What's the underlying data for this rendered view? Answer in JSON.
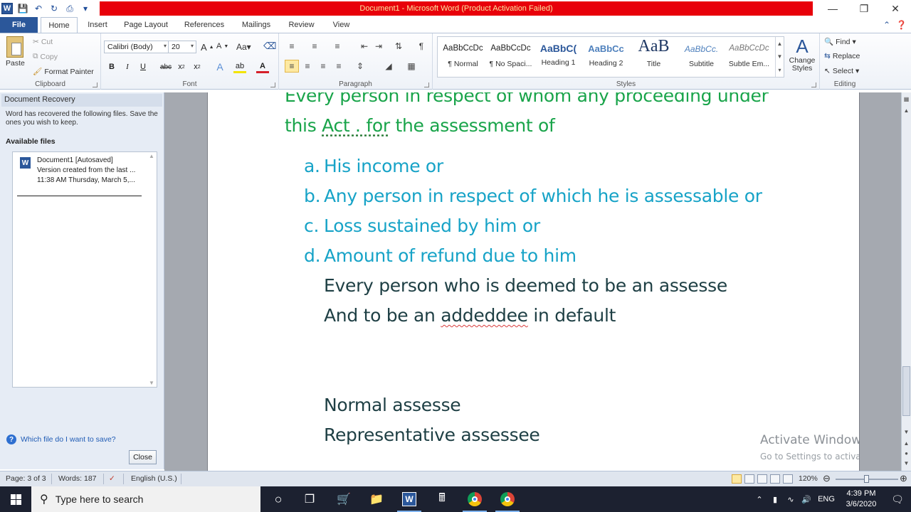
{
  "titlebar": {
    "title": "Document1  -  Microsoft Word (Product Activation Failed)"
  },
  "ribbon_tabs": [
    "File",
    "Home",
    "Insert",
    "Page Layout",
    "References",
    "Mailings",
    "Review",
    "View"
  ],
  "clipboard": {
    "paste": "Paste",
    "cut": "Cut",
    "copy": "Copy",
    "format_painter": "Format Painter",
    "group_label": "Clipboard"
  },
  "font": {
    "font_name": "Calibri (Body)",
    "font_size": "20",
    "group_label": "Font"
  },
  "paragraph": {
    "group_label": "Paragraph"
  },
  "styles": {
    "items": [
      {
        "preview": "AaBbCcDc",
        "name": "¶ Normal"
      },
      {
        "preview": "AaBbCcDc",
        "name": "¶ No Spaci..."
      },
      {
        "preview": "AaBbC(",
        "name": "Heading 1"
      },
      {
        "preview": "AaBbCc",
        "name": "Heading 2"
      },
      {
        "preview": "AaB",
        "name": "Title"
      },
      {
        "preview": "AaBbCc.",
        "name": "Subtitle"
      },
      {
        "preview": "AaBbCcDc",
        "name": "Subtle Em..."
      }
    ],
    "change_styles": "Change Styles",
    "group_label": "Styles"
  },
  "editing": {
    "find": "Find",
    "replace": "Replace",
    "select": "Select",
    "group_label": "Editing"
  },
  "recovery": {
    "header": "Document Recovery",
    "description": "Word has recovered the following files.  Save the ones you wish to keep.",
    "available_files": "Available files",
    "file_name": "Document1  [Autosaved]",
    "file_line2": "Version created from the last ...",
    "file_line3": "11:38 AM Thursday, March 5,...",
    "help_link": "Which file do I want to save?",
    "close": "Close"
  },
  "document": {
    "line_partial": "Every person in respect of whom any proceeding under",
    "line2_pre": "this ",
    "line2_act": "Act . for",
    "line2_post": " the assessment of",
    "list": [
      {
        "marker": "a.",
        "text": "His income  or"
      },
      {
        "marker": "b.",
        "text": "Any person in respect of which he is assessable or"
      },
      {
        "marker": "c.",
        "text": "Loss sustained by him  or"
      },
      {
        "marker": "d.",
        "text": "Amount of refund due to him"
      }
    ],
    "deemed": "Every person who is deemed to be an assesse",
    "default_pre": "And to be an ",
    "default_word": "addeddee",
    "default_post": " in default",
    "normal": "Normal assesse",
    "representative": "Representative assessee"
  },
  "watermark": {
    "title": "Activate Windows",
    "subtitle": "Go to Settings to activate Windows."
  },
  "statusbar": {
    "page": "Page: 3 of 3",
    "words": "Words: 187",
    "language": "English (U.S.)",
    "zoom": "120%"
  },
  "taskbar": {
    "search_placeholder": "Type here to search",
    "lang": "ENG",
    "time": "4:39 PM",
    "date": "3/6/2020"
  }
}
